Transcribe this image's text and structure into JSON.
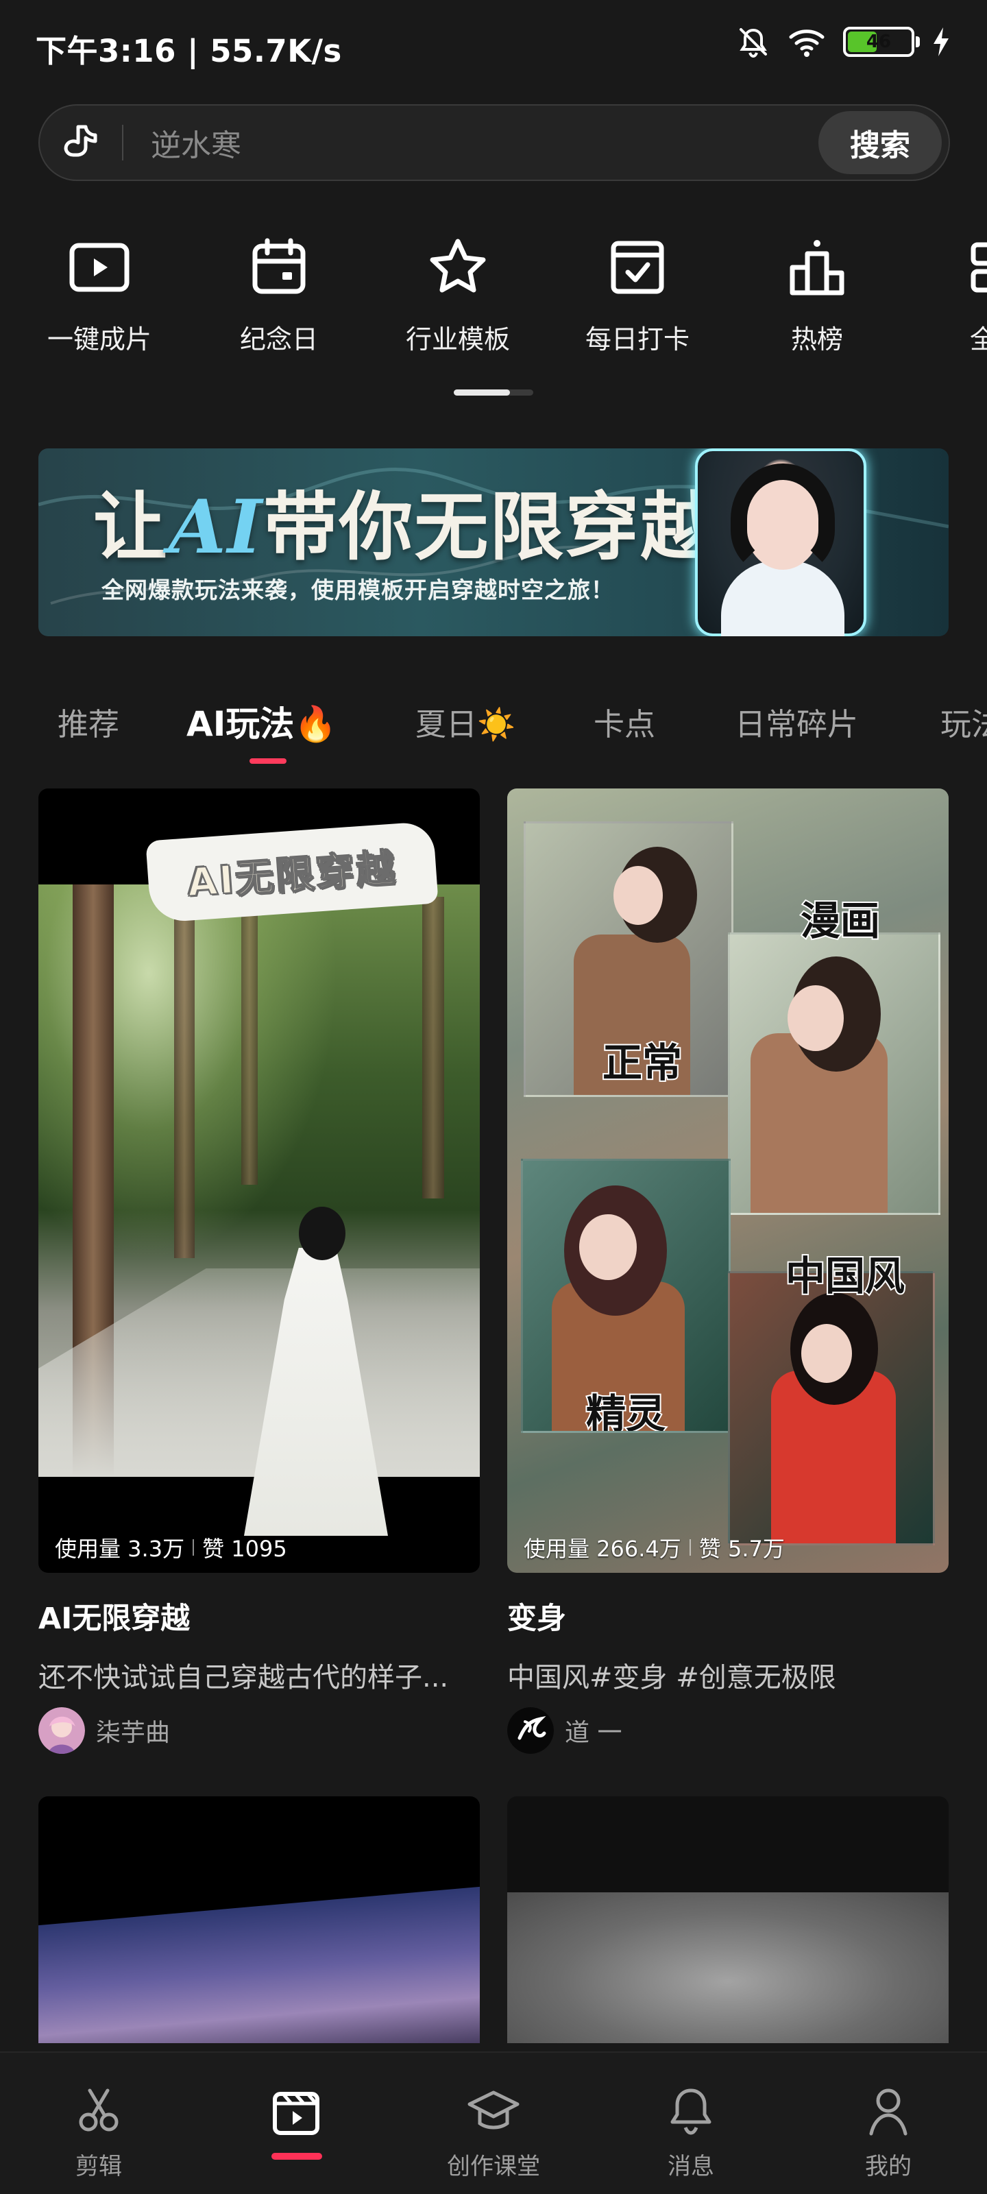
{
  "status_bar": {
    "time_network": "下午3:16 | 55.7K/s",
    "battery_level": "46"
  },
  "search": {
    "placeholder": "逆水寒",
    "button_label": "搜索"
  },
  "tools": [
    {
      "label": "一键成片",
      "icon": "video-play-icon"
    },
    {
      "label": "纪念日",
      "icon": "calendar-icon"
    },
    {
      "label": "行业模板",
      "icon": "star-icon"
    },
    {
      "label": "每日打卡",
      "icon": "check-calendar-icon"
    },
    {
      "label": "热榜",
      "icon": "podium-icon"
    },
    {
      "label": "全部",
      "icon": "grid-icon"
    }
  ],
  "banner": {
    "title_prefix": "让",
    "title_ai": "AI",
    "title_suffix": "带你无限穿越",
    "subtitle": "全网爆款玩法来袭，使用模板开启穿越时空之旅！"
  },
  "category_tabs": [
    "推荐",
    "AI玩法🔥",
    "夏日☀️",
    "卡点",
    "日常碎片",
    "玩法"
  ],
  "cards": [
    {
      "image_title": "AI无限穿越",
      "stats": {
        "usage": "使用量 3.3万",
        "likes": "赞 1095"
      },
      "title": "AI无限穿越",
      "description": "还不快试试自己穿越古代的样子...",
      "author": "柒芋曲"
    },
    {
      "image_labels": [
        "漫画",
        "正常",
        "中国风",
        "精灵"
      ],
      "stats": {
        "usage": "使用量 266.4万",
        "likes": "赞 5.7万"
      },
      "title": "变身",
      "description": "中国风#变身 #创意无极限",
      "author": "道 一"
    }
  ],
  "bottom_nav": [
    {
      "label": "剪辑",
      "icon": "scissors-icon"
    },
    {
      "label": "",
      "icon": "template-clapper-icon"
    },
    {
      "label": "创作课堂",
      "icon": "graduation-cap-icon"
    },
    {
      "label": "消息",
      "icon": "bell-icon"
    },
    {
      "label": "我的",
      "icon": "profile-icon"
    }
  ],
  "colors": {
    "background": "#191919",
    "accent": "#ff3b5c",
    "battery": "#58c42a",
    "banner_ai": "#74d2f2"
  }
}
